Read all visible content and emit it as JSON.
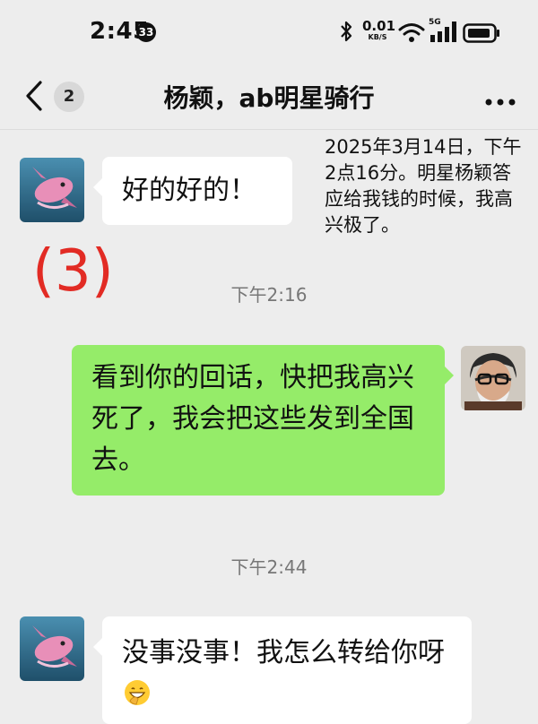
{
  "status_bar": {
    "time": "2:45",
    "notification_count": "33",
    "net_speed_value": "0.01",
    "net_speed_unit": "KB/S",
    "network_type": "5G"
  },
  "header": {
    "back_unread": "2",
    "title": "杨颖，ab明星骑行"
  },
  "caption": "2025年3月14日，下午2点16分。明星杨颖答应给我钱的时候，我高兴极了。",
  "annotation_number": "(3)",
  "messages": [
    {
      "side": "left",
      "text": "好的好的！"
    },
    {
      "timestamp": "下午2:16"
    },
    {
      "side": "right",
      "text": "看到你的回话，快把我高兴死了，我会把这些发到全国去。"
    },
    {
      "timestamp": "下午2:44"
    },
    {
      "side": "left",
      "text": "没事没事！我怎么转给你呀",
      "emoji": "grinning-face-with-hand-over-mouth"
    }
  ],
  "colors": {
    "background": "#ededed",
    "bubble_green": "#95ec69",
    "bubble_white": "#ffffff",
    "annotation_red": "#e22b24"
  }
}
